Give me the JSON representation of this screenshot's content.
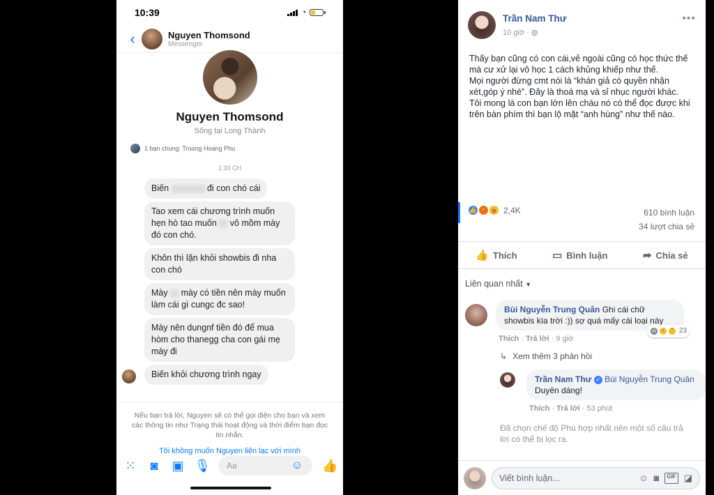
{
  "messenger": {
    "status": {
      "time": "10:39"
    },
    "header": {
      "name": "Nguyen Thomsond",
      "subtitle": "Messenger"
    },
    "profile": {
      "name": "Nguyen Thomsond",
      "location": "Sống tại Long Thành"
    },
    "mutual": "1 bạn chung: Truong Hoang Phu",
    "time_label": "1:33 CH",
    "messages": [
      {
        "before": "Biến",
        "after": "đi con chó cái"
      },
      {
        "before": "Tao xem cái chương trình muốn hẹn hò tao muốn",
        "after": "vô mồm mày đó con chó."
      },
      {
        "text": "Khôn thì lặn khỏi showbis đi nha con chó"
      },
      {
        "before": "Mày",
        "after": "mày có tiền nên mày muốn làm cái gì cungc đc sao!"
      },
      {
        "text": "Mày nên dungnf tiền đó để mua hòm cho thanegg cha con gái mẹ mày đi"
      },
      {
        "text": "Biến khỏi chương trình ngay"
      }
    ],
    "reply_note": "Nếu bạn trả lời, Nguyen sẽ có thể gọi điện cho bạn và xem các thông tin như Trạng thái hoạt động và thời điểm bạn đọc tin nhắn.",
    "block_link": "Tôi không muốn Nguyen liên lạc với mình",
    "composer_placeholder": "Aa",
    "accent": "#0a7cff"
  },
  "facebook": {
    "author": "Trần Nam Thư",
    "time": "10 giờ",
    "body": "Thấy bạn cũng có con cái,vẻ ngoài cũng có học thức thế mà cư xử lại vô học 1 cách khủng khiếp như thế.\nMọi người đừng cmt nói là “khán giả có quyền nhận xét,góp ý nhé”. Đây là thoá mạ và sỉ nhục người khác.\nTôi mong là con bạn lớn lên cháu nó có thể đọc được khi trên bàn phím thì bạn lộ mặt “anh hùng” như thế nào.",
    "reaction_count": "2,4K",
    "comment_count": "610 bình luận",
    "share_count": "34 lượt chia sẻ",
    "actions": {
      "like": "Thích",
      "comment": "Bình luận",
      "share": "Chia sẻ"
    },
    "sort_label": "Liên quan nhất",
    "comment1": {
      "author": "Bùi Nguyễn Trung Quân",
      "text": "Ghi cái chữ showbis kìa trời :)) sợ quá mấy cái loại này",
      "like": "Thích",
      "reply": "Trả lời",
      "time": "9 giờ",
      "reaction_count": "23"
    },
    "more_replies": "Xem thêm 3 phản hồi",
    "reply1": {
      "author": "Trần Nam Thư",
      "mention": "Bùi Nguyễn Trung Quân",
      "text": "Duyên dáng!",
      "like": "Thích",
      "reply": "Trả lời",
      "time": "53 phút"
    },
    "filter_note": "Đã chọn chế độ Phù hợp nhất nên một số câu trả lời có thể bị lọc ra.",
    "composer_placeholder": "Viết bình luận...",
    "link_color": "#385898"
  }
}
